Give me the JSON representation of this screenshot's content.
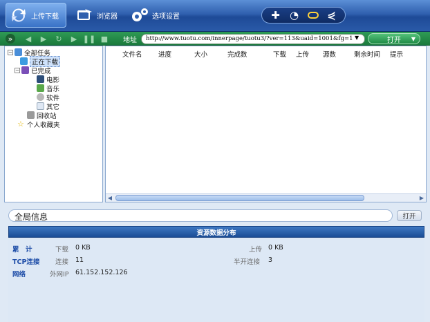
{
  "toolbar": {
    "upload_download": "上传下载",
    "browser": "浏览器",
    "options": "选项设置"
  },
  "address": {
    "label": "地址",
    "url": "http://www.tuotu.com/innerpage/tuotu3/?ver=113&uaid=1001&fg=1",
    "open": "打开"
  },
  "tree": {
    "all_tasks": "全部任务",
    "downloading": "正在下载",
    "completed": "已完成",
    "movies": "电影",
    "music": "音乐",
    "software": "软件",
    "other": "其它",
    "recycle": "回收站",
    "favorites": "个人收藏夹"
  },
  "list_columns": [
    "文件名",
    "进度",
    "大小",
    "完成数",
    "下载",
    "上传",
    "源数",
    "剩余时间",
    "提示"
  ],
  "info": {
    "title": "全局信息",
    "open": "打开",
    "distribution": "资源数据分布"
  },
  "stats": {
    "cat_total": "累　计",
    "cat_tcp": "TCP连接",
    "cat_net": "网络",
    "download_label": "下载",
    "download_value": "0 KB",
    "upload_label": "上传",
    "upload_value": "0 KB",
    "conn_label": "连接",
    "conn_value": "11",
    "halfopen_label": "半开连接",
    "halfopen_value": "3",
    "extip_label": "外网IP",
    "extip_value": "61.152.152.126"
  },
  "icons": {
    "upload_download": "transfer-arrows-icon",
    "browser": "browser-icon",
    "options": "gears-icon",
    "add": "plus-icon",
    "timer": "clock-icon",
    "minimize": "minimize-icon",
    "shrink": "collapse-icon"
  }
}
